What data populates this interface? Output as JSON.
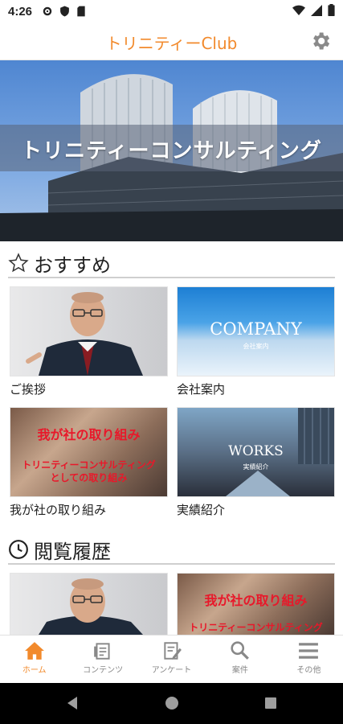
{
  "status": {
    "time": "4:26"
  },
  "app": {
    "title": "トリニティーClub"
  },
  "hero": {
    "text": "トリニティーコンサルティング"
  },
  "recommended": {
    "heading": "おすすめ",
    "items": [
      {
        "caption": "ご挨拶"
      },
      {
        "caption": "会社案内",
        "overlay_title": "COMPANY",
        "overlay_sub": "会社案内"
      },
      {
        "caption": "我が社の取り組み",
        "overlay_line1": "我が社の取り組み",
        "overlay_line2": "トリニティーコンサルティング",
        "overlay_line3": "としての取り組み"
      },
      {
        "caption": "実績紹介",
        "overlay_title": "WORKS",
        "overlay_sub": "実績紹介"
      }
    ]
  },
  "history": {
    "heading": "閲覧履歴",
    "items": [
      {},
      {
        "overlay_line1": "我が社の取り組み",
        "overlay_line2": "トリニティーコンサルティング"
      }
    ]
  },
  "nav": {
    "items": [
      {
        "label": "ホーム",
        "icon": "home-icon"
      },
      {
        "label": "コンテンツ",
        "icon": "contents-icon"
      },
      {
        "label": "アンケート",
        "icon": "survey-icon"
      },
      {
        "label": "案件",
        "icon": "search-icon"
      },
      {
        "label": "その他",
        "icon": "menu-icon"
      }
    ]
  },
  "colors": {
    "accent": "#f28a2c",
    "inactive": "#888888"
  }
}
